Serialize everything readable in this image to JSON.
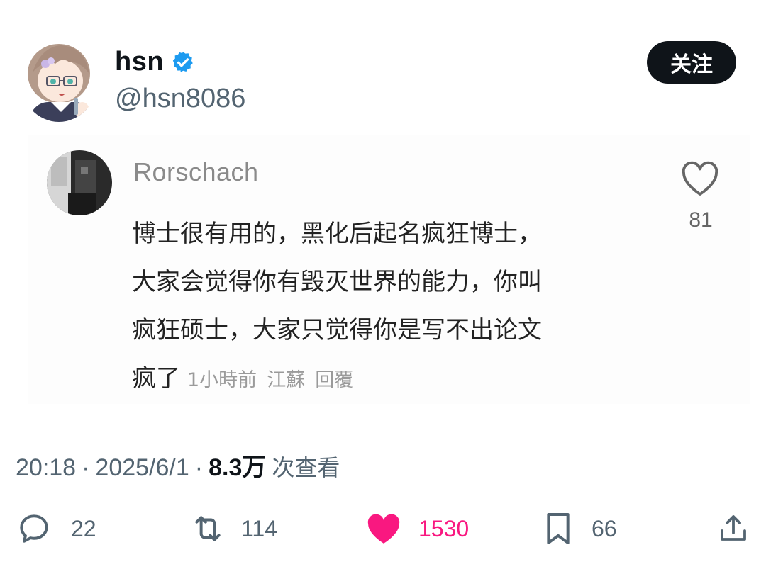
{
  "post": {
    "display_name": "hsn",
    "handle": "@hsn8086",
    "follow_label": "关注"
  },
  "comment": {
    "author": "Rorschach",
    "lines": [
      "博士很有用的，黑化后起名疯狂博士，",
      "大家会觉得你有毁灭世界的能力，你叫",
      "疯狂硕士，大家只觉得你是写不出论文"
    ],
    "last_line": "疯了",
    "time": "1小時前",
    "location": "江蘇",
    "reply_label": "回覆",
    "like_count": "81"
  },
  "stats": {
    "time": "20:18",
    "date": "2025/6/1",
    "views": "8.3万",
    "views_label": "次查看"
  },
  "actions": {
    "replies": "22",
    "reposts": "114",
    "likes": "1530",
    "bookmarks": "66"
  },
  "colors": {
    "accent_like": "#f91880",
    "verified_blue": "#1d9bf0",
    "muted": "#536471"
  }
}
